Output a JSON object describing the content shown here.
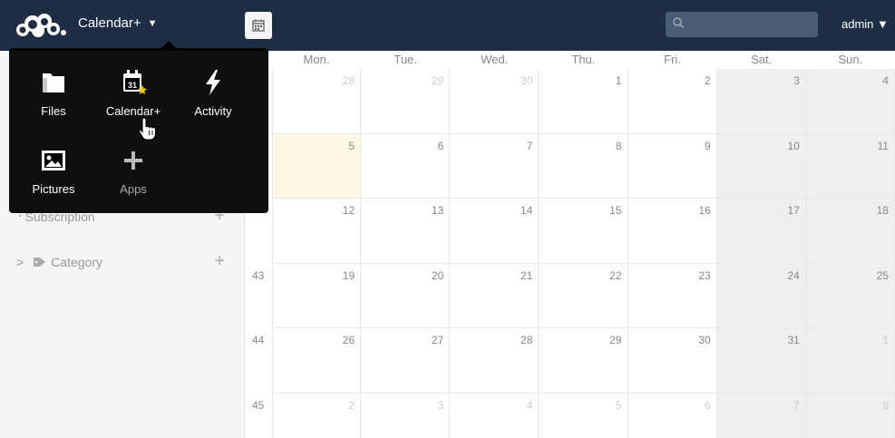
{
  "header": {
    "app_name": "Calendar+",
    "app_caret": "▼",
    "user_label": "admin ▼",
    "search_placeholder": ""
  },
  "apps_menu": [
    {
      "label": "Files",
      "icon": "folder-icon"
    },
    {
      "label": "Calendar+",
      "icon": "calendar-star-icon"
    },
    {
      "label": "Activity",
      "icon": "lightning-icon"
    },
    {
      "label": "Pictures",
      "icon": "picture-icon"
    },
    {
      "label": "Apps",
      "icon": "plus-icon"
    }
  ],
  "sidebar": {
    "subscription": {
      "label": "Subscription",
      "add": "+"
    },
    "category": {
      "chevron": ">",
      "label": "Category",
      "add": "+"
    }
  },
  "calendar": {
    "days_of_week": [
      "Mon.",
      "Tue.",
      "Wed.",
      "Thu.",
      "Fri.",
      "Sat.",
      "Sun."
    ],
    "weeks": [
      {
        "week": "",
        "days": [
          "28",
          "29",
          "30",
          "1",
          "2",
          "3",
          "4"
        ]
      },
      {
        "week": "",
        "days": [
          "5",
          "6",
          "7",
          "8",
          "9",
          "10",
          "11"
        ]
      },
      {
        "week": "",
        "days": [
          "12",
          "13",
          "14",
          "15",
          "16",
          "17",
          "18"
        ]
      },
      {
        "week": "43",
        "days": [
          "19",
          "20",
          "21",
          "22",
          "23",
          "24",
          "25"
        ]
      },
      {
        "week": "44",
        "days": [
          "26",
          "27",
          "28",
          "29",
          "30",
          "31",
          "1"
        ]
      },
      {
        "week": "45",
        "days": [
          "2",
          "3",
          "4",
          "5",
          "6",
          "7",
          "8"
        ]
      }
    ],
    "other_month": [
      [
        true,
        true,
        true,
        false,
        false,
        false,
        false
      ],
      [
        false,
        false,
        false,
        false,
        false,
        false,
        false
      ],
      [
        false,
        false,
        false,
        false,
        false,
        false,
        false
      ],
      [
        false,
        false,
        false,
        false,
        false,
        false,
        false
      ],
      [
        false,
        false,
        false,
        false,
        false,
        false,
        true
      ],
      [
        true,
        true,
        true,
        true,
        true,
        true,
        true
      ]
    ],
    "today": {
      "week_index": 1,
      "day_index": 0
    },
    "colors": {
      "header_bg": "#1d2d44",
      "today_bg": "#fcf8e3",
      "weekend_bg": "#efefef",
      "menu_star": "#f5c518"
    }
  }
}
